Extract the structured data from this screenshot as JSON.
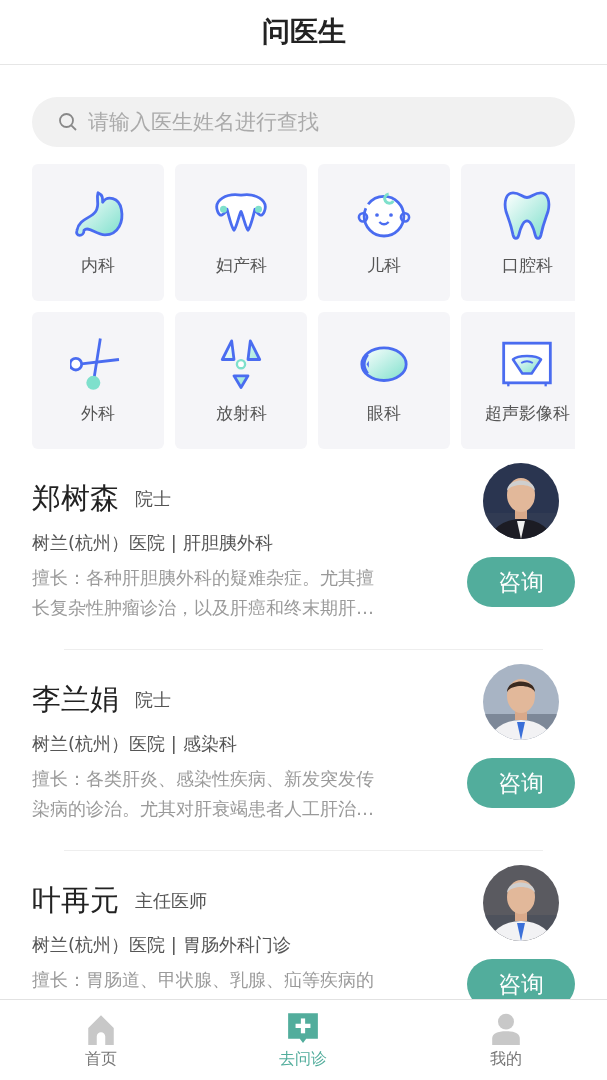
{
  "header": {
    "title": "问医生"
  },
  "search": {
    "placeholder": "请输入医生姓名进行查找"
  },
  "departments": [
    {
      "label": "内科"
    },
    {
      "label": "妇产科"
    },
    {
      "label": "儿科"
    },
    {
      "label": "口腔科"
    },
    {
      "label": "外科"
    },
    {
      "label": "放射科"
    },
    {
      "label": "眼科"
    },
    {
      "label": "超声影像科"
    }
  ],
  "doctors": [
    {
      "name": "郑树森",
      "title": "院士",
      "hospital": "树兰(杭州）医院 | 肝胆胰外科",
      "expertise": "擅长：各种肝胆胰外科的疑难杂症。尤其擅长复杂性肿瘤诊治，以及肝癌和终末期肝…",
      "button": "咨询"
    },
    {
      "name": "李兰娟",
      "title": "院士",
      "hospital": "树兰(杭州）医院 | 感染科",
      "expertise": "擅长：各类肝炎、感染性疾病、新发突发传染病的诊治。尤其对肝衰竭患者人工肝治…",
      "button": "咨询"
    },
    {
      "name": "叶再元",
      "title": "主任医师",
      "hospital": "树兰(杭州）医院 | 胃肠外科门诊",
      "expertise": "擅长：胃肠道、甲状腺、乳腺、疝等疾病的",
      "button": "咨询"
    }
  ],
  "tab_bar": [
    {
      "label": "首页",
      "selected": false
    },
    {
      "label": "去问诊",
      "selected": true
    },
    {
      "label": "我的",
      "selected": false
    }
  ]
}
